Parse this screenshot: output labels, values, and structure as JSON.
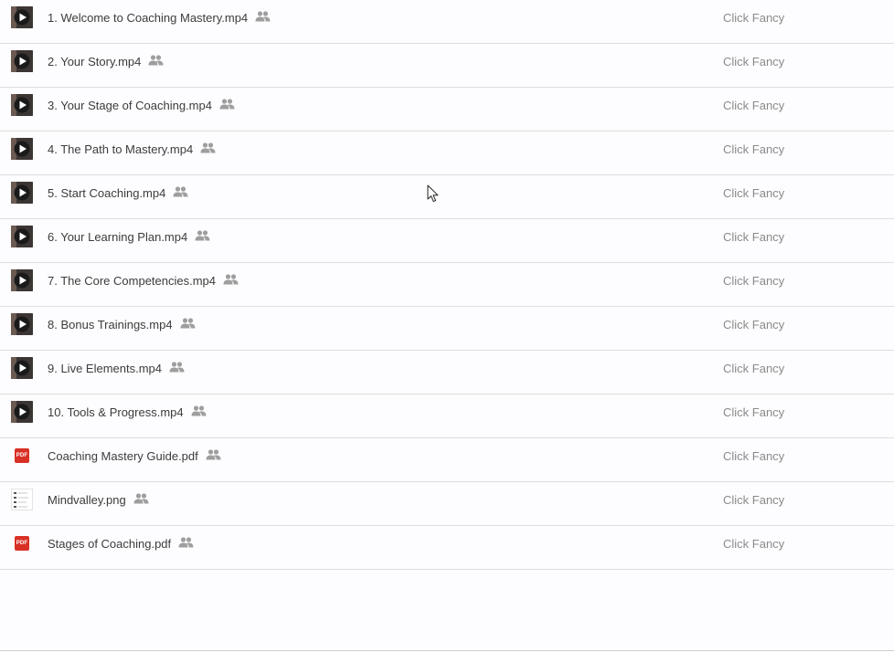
{
  "files": [
    {
      "name": "1. Welcome to Coaching Mastery.mp4",
      "owner": "Click Fancy",
      "type": "video"
    },
    {
      "name": "2. Your Story.mp4",
      "owner": "Click Fancy",
      "type": "video"
    },
    {
      "name": "3. Your Stage of Coaching.mp4",
      "owner": "Click Fancy",
      "type": "video"
    },
    {
      "name": "4. The Path to Mastery.mp4",
      "owner": "Click Fancy",
      "type": "video"
    },
    {
      "name": "5. Start Coaching.mp4",
      "owner": "Click Fancy",
      "type": "video"
    },
    {
      "name": "6. Your Learning Plan.mp4",
      "owner": "Click Fancy",
      "type": "video"
    },
    {
      "name": "7. The Core Competencies.mp4",
      "owner": "Click Fancy",
      "type": "video"
    },
    {
      "name": "8. Bonus Trainings.mp4",
      "owner": "Click Fancy",
      "type": "video"
    },
    {
      "name": "9. Live Elements.mp4",
      "owner": "Click Fancy",
      "type": "video"
    },
    {
      "name": "10. Tools & Progress.mp4",
      "owner": "Click Fancy",
      "type": "video"
    },
    {
      "name": "Coaching Mastery Guide.pdf",
      "owner": "Click Fancy",
      "type": "pdf"
    },
    {
      "name": "Mindvalley.png",
      "owner": "Click Fancy",
      "type": "image"
    },
    {
      "name": "Stages of Coaching.pdf",
      "owner": "Click Fancy",
      "type": "pdf"
    }
  ],
  "pdf_badge": "PDF",
  "icons": {
    "video": "video-thumbnail-icon",
    "pdf": "pdf-icon",
    "image": "image-thumbnail-icon",
    "shared": "shared-people-icon",
    "cursor": "mouse-cursor-icon"
  },
  "colors": {
    "background": "#fdfcfe",
    "divider": "#dedede",
    "name_text": "#3c3c3c",
    "owner_text": "#8a8a8a",
    "shared_icon": "#9e9e9e",
    "pdf_red": "#d93025",
    "video_thumb": "#3b3533"
  }
}
